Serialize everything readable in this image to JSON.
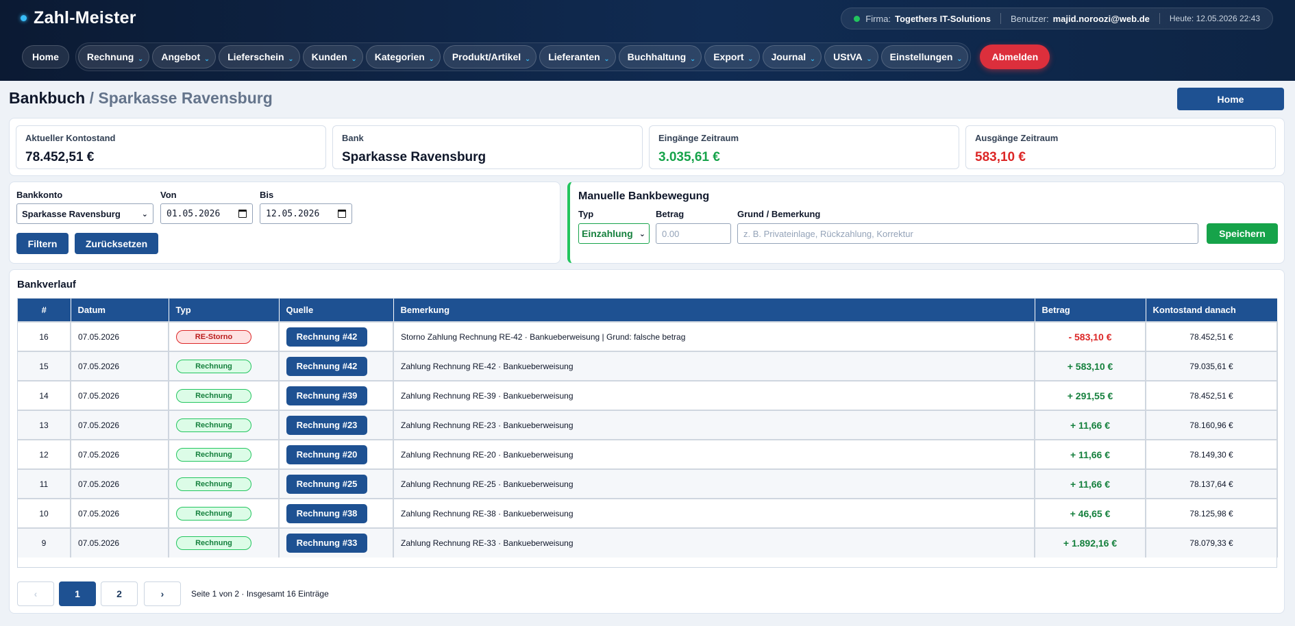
{
  "app": {
    "name": "Zahl-Meister"
  },
  "header": {
    "firma_label": "Firma:",
    "firma_value": "Togethers IT-Solutions",
    "user_label": "Benutzer:",
    "user_value": "majid.noroozi@web.de",
    "today": "Heute: 12.05.2026 22:43"
  },
  "nav": {
    "home": "Home",
    "items": [
      "Rechnung",
      "Angebot",
      "Lieferschein",
      "Kunden",
      "Kategorien",
      "Produkt/Artikel",
      "Lieferanten",
      "Buchhaltung",
      "Export",
      "Journal",
      "UStVA",
      "Einstellungen"
    ],
    "logout": "Abmelden"
  },
  "page": {
    "title": "Bankbuch",
    "separator": " / ",
    "subtitle": "Sparkasse Ravensburg",
    "home_button": "Home"
  },
  "stats": [
    {
      "label": "Aktueller Kontostand",
      "value": "78.452,51 €",
      "color": "#0f172a"
    },
    {
      "label": "Bank",
      "value": "Sparkasse Ravensburg",
      "color": "#0f172a"
    },
    {
      "label": "Eingänge Zeitraum",
      "value": "3.035,61 €",
      "color": "#16a34a"
    },
    {
      "label": "Ausgänge Zeitraum",
      "value": "583,10 €",
      "color": "#dc2626"
    }
  ],
  "filter": {
    "account_label": "Bankkonto",
    "account_value": "Sparkasse Ravensburg",
    "from_label": "Von",
    "from_value": "01.05.2026",
    "to_label": "Bis",
    "to_value": "12.05.2026",
    "filter_button": "Filtern",
    "reset_button": "Zurücksetzen"
  },
  "manual": {
    "title": "Manuelle Bankbewegung",
    "type_label": "Typ",
    "type_value": "Einzahlung",
    "amount_label": "Betrag",
    "amount_placeholder": "0.00",
    "reason_label": "Grund / Bemerkung",
    "reason_placeholder": "z. B. Privateinlage, Rückzahlung, Korrektur",
    "save_button": "Speichern"
  },
  "table": {
    "title": "Bankverlauf",
    "columns": [
      "#",
      "Datum",
      "Typ",
      "Quelle",
      "Bemerkung",
      "Betrag",
      "Kontostand danach"
    ],
    "rows": [
      {
        "id": "16",
        "date": "07.05.2026",
        "type": "RE-Storno",
        "type_kind": "red",
        "source": "Rechnung #42",
        "note": "Storno Zahlung Rechnung RE-42 · Bankueberweisung | Grund: falsche betrag",
        "amount": "- 583,10 €",
        "amount_kind": "neg",
        "balance": "78.452,51 €"
      },
      {
        "id": "15",
        "date": "07.05.2026",
        "type": "Rechnung",
        "type_kind": "green",
        "source": "Rechnung #42",
        "note": "Zahlung Rechnung RE-42 · Bankueberweisung",
        "amount": "+ 583,10 €",
        "amount_kind": "pos",
        "balance": "79.035,61 €"
      },
      {
        "id": "14",
        "date": "07.05.2026",
        "type": "Rechnung",
        "type_kind": "green",
        "source": "Rechnung #39",
        "note": "Zahlung Rechnung RE-39 · Bankueberweisung",
        "amount": "+ 291,55 €",
        "amount_kind": "pos",
        "balance": "78.452,51 €"
      },
      {
        "id": "13",
        "date": "07.05.2026",
        "type": "Rechnung",
        "type_kind": "green",
        "source": "Rechnung #23",
        "note": "Zahlung Rechnung RE-23 · Bankueberweisung",
        "amount": "+ 11,66 €",
        "amount_kind": "pos",
        "balance": "78.160,96 €"
      },
      {
        "id": "12",
        "date": "07.05.2026",
        "type": "Rechnung",
        "type_kind": "green",
        "source": "Rechnung #20",
        "note": "Zahlung Rechnung RE-20 · Bankueberweisung",
        "amount": "+ 11,66 €",
        "amount_kind": "pos",
        "balance": "78.149,30 €"
      },
      {
        "id": "11",
        "date": "07.05.2026",
        "type": "Rechnung",
        "type_kind": "green",
        "source": "Rechnung #25",
        "note": "Zahlung Rechnung RE-25 · Bankueberweisung",
        "amount": "+ 11,66 €",
        "amount_kind": "pos",
        "balance": "78.137,64 €"
      },
      {
        "id": "10",
        "date": "07.05.2026",
        "type": "Rechnung",
        "type_kind": "green",
        "source": "Rechnung #38",
        "note": "Zahlung Rechnung RE-38 · Bankueberweisung",
        "amount": "+ 46,65 €",
        "amount_kind": "pos",
        "balance": "78.125,98 €"
      },
      {
        "id": "9",
        "date": "07.05.2026",
        "type": "Rechnung",
        "type_kind": "green",
        "source": "Rechnung #33",
        "note": "Zahlung Rechnung RE-33 · Bankueberweisung",
        "amount": "+ 1.892,16 €",
        "amount_kind": "pos",
        "balance": "78.079,33 €"
      }
    ]
  },
  "pagination": {
    "prev": "‹",
    "pages": [
      "1",
      "2"
    ],
    "current": "1",
    "next": "›",
    "info": "Seite 1 von 2 · Insgesamt 16 Einträge"
  }
}
